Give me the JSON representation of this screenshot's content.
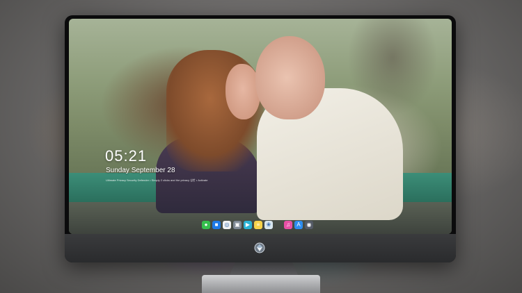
{
  "lock_screen": {
    "time": "05:21",
    "date": "Sunday September 28",
    "notice": "Ultimate Privacy Security Defender  •  Simply 2 clicks and the privacy 삼한 • Activate"
  },
  "dock": {
    "apps": [
      {
        "name": "messages-icon",
        "color": "#35c04d",
        "glyph": "●"
      },
      {
        "name": "finder-icon",
        "color": "#1e7ae8",
        "glyph": "■"
      },
      {
        "name": "safari-icon",
        "color": "#f2f2f2",
        "glyph": "◎"
      },
      {
        "name": "preview-icon",
        "color": "#7f8a95",
        "glyph": "▣"
      },
      {
        "name": "finalcut-icon",
        "color": "#2bb4d6",
        "glyph": "▶"
      },
      {
        "name": "notes-icon",
        "color": "#f7d34a",
        "glyph": "≡"
      },
      {
        "name": "photos-icon",
        "color": "#d8e7ef",
        "glyph": "❀"
      },
      {
        "name": "itunes-icon",
        "color": "#e84fa5",
        "glyph": "♫"
      },
      {
        "name": "appstore-icon",
        "color": "#2d8df0",
        "glyph": "A"
      },
      {
        "name": "camera-icon",
        "color": "#555b66",
        "glyph": "◉"
      }
    ]
  },
  "monitor": {
    "logo_icon": "diamond-logo-icon"
  }
}
